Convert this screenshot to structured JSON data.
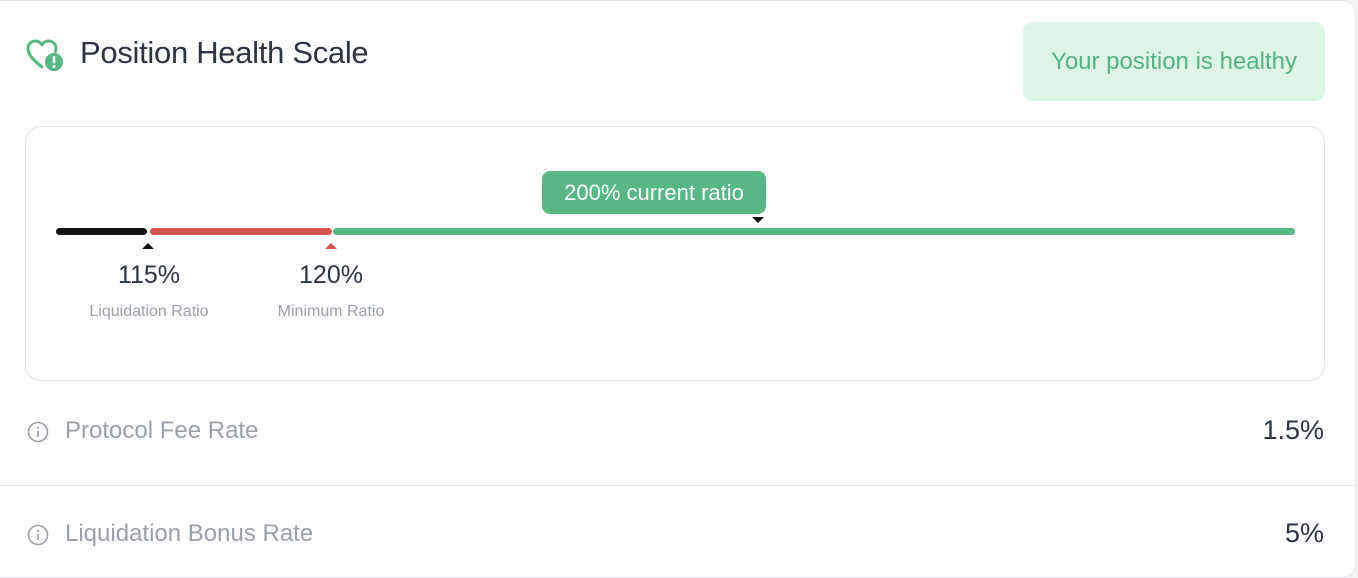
{
  "header": {
    "icon": "heart-alert-icon",
    "title": "Position Health Scale",
    "status": "Your position is healthy"
  },
  "scale": {
    "current_label": "200% current ratio",
    "current_value": 200,
    "markers": [
      {
        "value": "115%",
        "label": "Liquidation Ratio"
      },
      {
        "value": "120%",
        "label": "Minimum Ratio"
      }
    ]
  },
  "rows": [
    {
      "icon": "info-icon",
      "label": "Protocol Fee Rate",
      "value": "1.5%"
    },
    {
      "icon": "info-icon",
      "label": "Liquidation Bonus Rate",
      "value": "5%"
    }
  ],
  "colors": {
    "healthy": "#58b782",
    "danger": "#d6554f",
    "liquidation": "#111111",
    "status_bg": "#dcf5e6"
  }
}
